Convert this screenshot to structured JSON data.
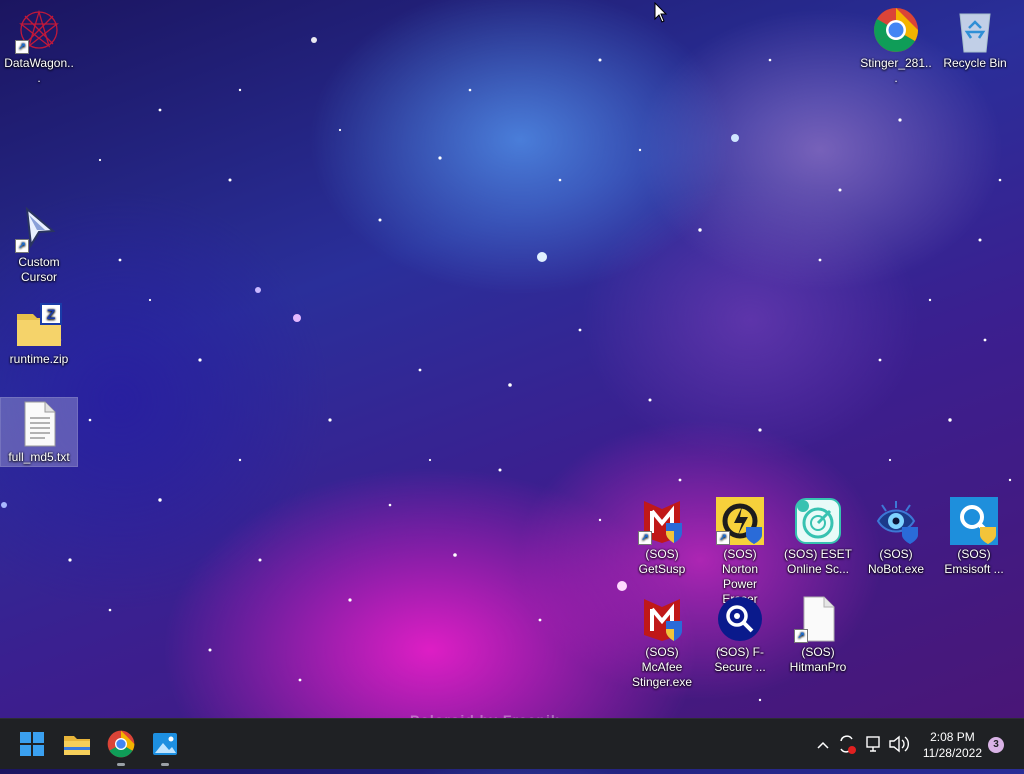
{
  "desktop": {
    "icons": [
      {
        "label": "DataWagon...",
        "icon": "datawagon-icon"
      },
      {
        "label": "Custom Cursor",
        "icon": "custom-cursor-icon"
      },
      {
        "label": "runtime.zip",
        "icon": "zip-folder-icon"
      },
      {
        "label": "full_md5.txt",
        "icon": "text-file-icon"
      },
      {
        "label": "Stinger_281...",
        "icon": "chrome-icon"
      },
      {
        "label": "Recycle Bin",
        "icon": "recycle-bin-icon"
      },
      {
        "label": "(SOS) GetSusp",
        "icon": "mcafee-icon"
      },
      {
        "label": "(SOS) Norton Power Eraser",
        "icon": "norton-icon"
      },
      {
        "label": "(SOS) ESET Online Sc...",
        "icon": "eset-icon"
      },
      {
        "label": "(SOS) NoBot.exe",
        "icon": "nobot-icon"
      },
      {
        "label": "(SOS) Emsisoft ...",
        "icon": "emsisoft-icon"
      },
      {
        "label": "(SOS) McAfee Stinger.exe",
        "icon": "mcafee-icon"
      },
      {
        "label": "(SOS) F-Secure ...",
        "icon": "fsecure-icon"
      },
      {
        "label": "(SOS) HitmanPro",
        "icon": "blank-file-icon"
      }
    ],
    "watermark": "Poloroid by Freepik"
  },
  "taskbar": {
    "apps": [
      "start-icon",
      "file-explorer-icon",
      "chrome-icon",
      "photos-icon"
    ],
    "tray": {
      "time": "2:08 PM",
      "date": "11/28/2022",
      "notification_count": "3"
    }
  },
  "colors": {
    "taskbar": "#1f2124",
    "accent_blue": "#1a6fd8"
  }
}
